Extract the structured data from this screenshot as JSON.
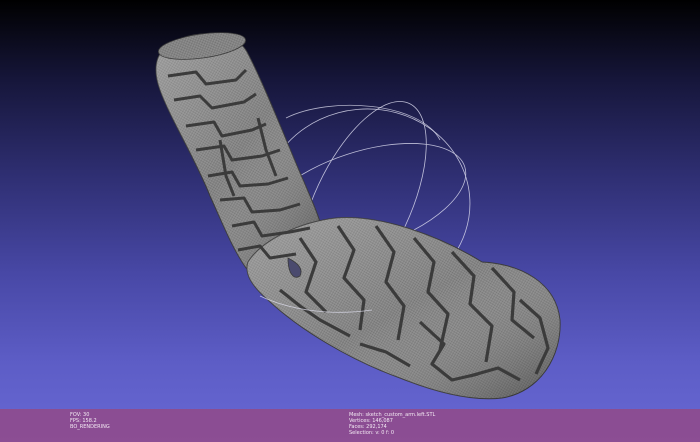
{
  "viewer": {
    "background_top": "#000000",
    "background_bottom": "#6868d4",
    "mesh_color": "#8c8c8c",
    "mesh_edge_color": "#3a3a3a",
    "trackball_color": "#d8d8ec",
    "status_bar_color": "#9a4684",
    "status_text_color": "#f4eaf4"
  },
  "status_bar": {
    "left": {
      "fov": "FOV: 30",
      "fps": "FPS:  158.2",
      "render_mode": "BO_RENDERING"
    },
    "right": {
      "mesh": "Mesh: sketch_custom_arm.left.STL",
      "vertices": "Vertices: 146,087",
      "faces": "Faces: 292,174",
      "selection": "Selection: v: 0 f: 0"
    }
  }
}
